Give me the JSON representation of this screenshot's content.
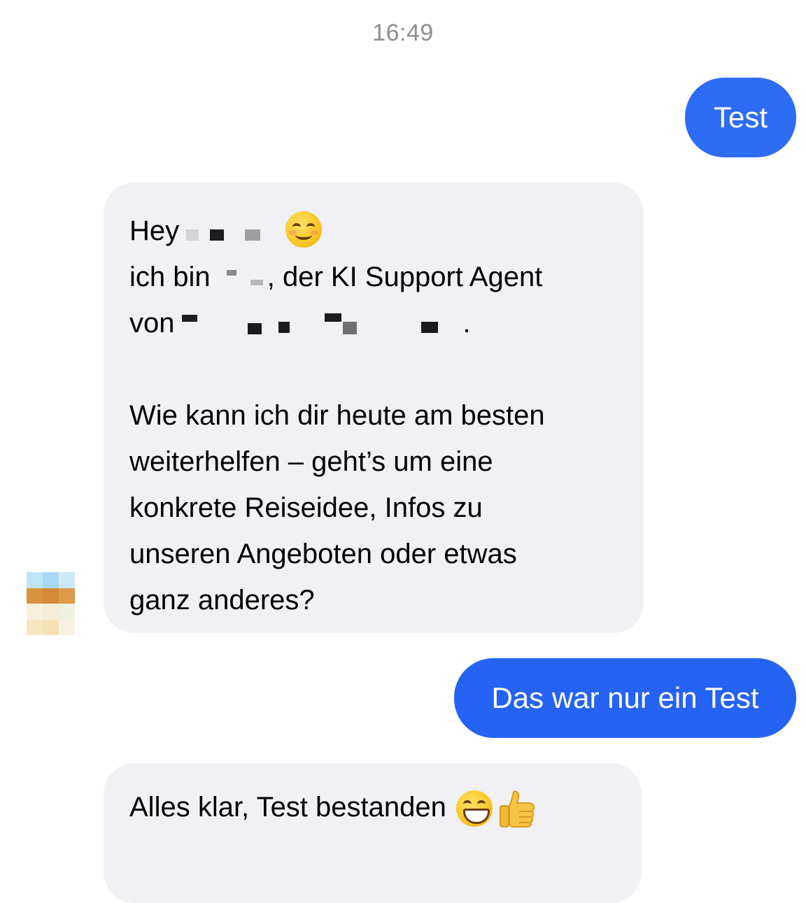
{
  "timestamp": "16:49",
  "accent_colors": {
    "outgoing_bubble": "#2d6df6",
    "outgoing_bubble_secondary": "#2563f5",
    "incoming_bubble": "#f0f0f5",
    "timestamp_text": "#8e8e93"
  },
  "messages": [
    {
      "direction": "outgoing",
      "text": "Test"
    },
    {
      "direction": "incoming",
      "line1_greeting": "Hey",
      "line1_emoji": "smiling-face-with-smiling-eyes",
      "line2_start": "ich bin",
      "line2_end": ", der KI Support Agent",
      "line3_start": "von",
      "line3_end": ".",
      "paragraph2": [
        "Wie kann ich dir heute am besten",
        "weiterhelfen – geht’s um eine",
        "konkrete Reiseidee, Infos zu",
        "unseren Angeboten oder etwas",
        "ganz anderes?"
      ]
    },
    {
      "direction": "outgoing",
      "text": "Das war nur ein Test"
    },
    {
      "direction": "incoming",
      "text": "Alles klar, Test bestanden",
      "emojis": [
        "grinning-face-with-smiling-eyes",
        "thumbs-up"
      ]
    }
  ]
}
